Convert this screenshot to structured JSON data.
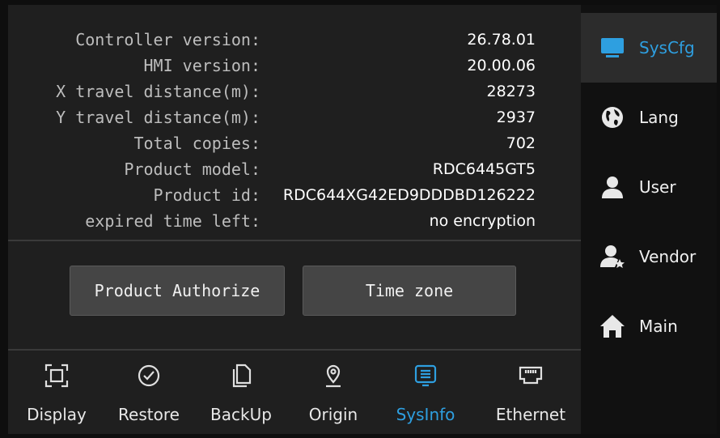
{
  "info": {
    "rows": [
      {
        "label": "Controller version:",
        "value": "26.78.01"
      },
      {
        "label": "HMI version:",
        "value": "20.00.06"
      },
      {
        "label": "X travel distance(m):",
        "value": "28273"
      },
      {
        "label": "Y travel distance(m):",
        "value": "2937"
      },
      {
        "label": "Total copies:",
        "value": "702"
      },
      {
        "label": "Product model:",
        "value": "RDC6445GT5"
      },
      {
        "label": "Product id:",
        "value": "RDC644XG42ED9DDDBD126222"
      },
      {
        "label": "expired time left:",
        "value": "no encryption"
      }
    ]
  },
  "buttons": {
    "authorize": "Product Authorize",
    "timezone": "Time zone"
  },
  "tabs": [
    {
      "label": "Display",
      "icon": "display-icon"
    },
    {
      "label": "Restore",
      "icon": "restore-icon"
    },
    {
      "label": "BackUp",
      "icon": "backup-icon"
    },
    {
      "label": "Origin",
      "icon": "origin-icon"
    },
    {
      "label": "SysInfo",
      "icon": "sysinfo-icon",
      "active": true
    },
    {
      "label": "Ethernet",
      "icon": "ethernet-icon"
    }
  ],
  "sidebar": {
    "items": [
      {
        "label": "SysCfg",
        "icon": "monitor-icon",
        "active": true
      },
      {
        "label": "Lang",
        "icon": "globe-icon"
      },
      {
        "label": "User",
        "icon": "user-icon"
      },
      {
        "label": "Vendor",
        "icon": "vendor-icon"
      },
      {
        "label": "Main",
        "icon": "home-icon"
      }
    ]
  },
  "colors": {
    "accent": "#2e9fe0",
    "background": "#1f1f1f",
    "sidebar": "#111111",
    "button": "#454545"
  }
}
